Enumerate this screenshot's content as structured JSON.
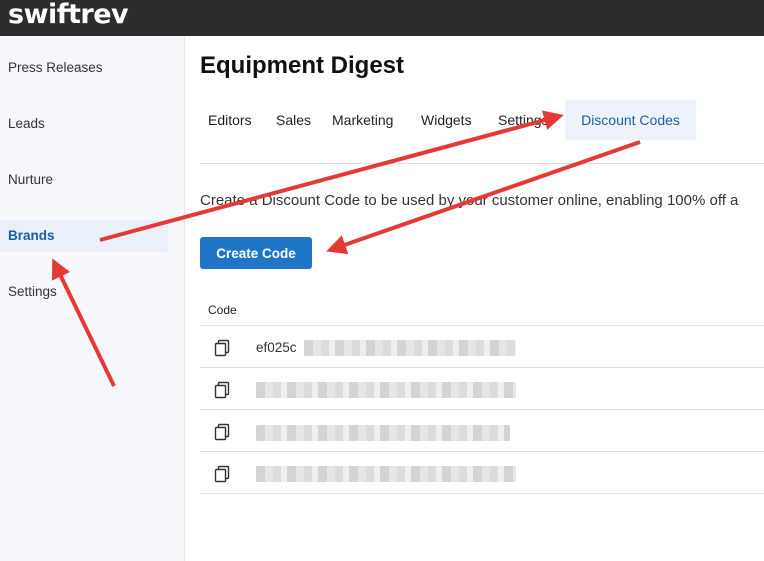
{
  "app": {
    "logo": "swiftrev"
  },
  "sidebar": {
    "items": [
      {
        "label": "Press Releases",
        "active": false
      },
      {
        "label": "Leads",
        "active": false
      },
      {
        "label": "Nurture",
        "active": false
      },
      {
        "label": "Brands",
        "active": true
      },
      {
        "label": "Settings",
        "active": false
      }
    ]
  },
  "page": {
    "title": "Equipment Digest"
  },
  "tabs": [
    {
      "label": "Editors"
    },
    {
      "label": "Sales"
    },
    {
      "label": "Marketing"
    },
    {
      "label": "Widgets"
    },
    {
      "label": "Settings"
    },
    {
      "label": "Discount Codes",
      "active": true
    }
  ],
  "description": "Create a Discount Code to be used by your customer online, enabling 100% off a",
  "create_button": {
    "label": "Create Code"
  },
  "table": {
    "header": "Code",
    "rows": [
      {
        "code": "ef025c"
      },
      {
        "code": ""
      },
      {
        "code": ""
      },
      {
        "code": ""
      }
    ]
  },
  "colors": {
    "accent": "#1f76c9",
    "annotation_arrow": "#e53935",
    "topbar": "#2d2d2d"
  },
  "icons": {
    "copy": "copy-icon",
    "arrow": "annotation-arrow"
  }
}
